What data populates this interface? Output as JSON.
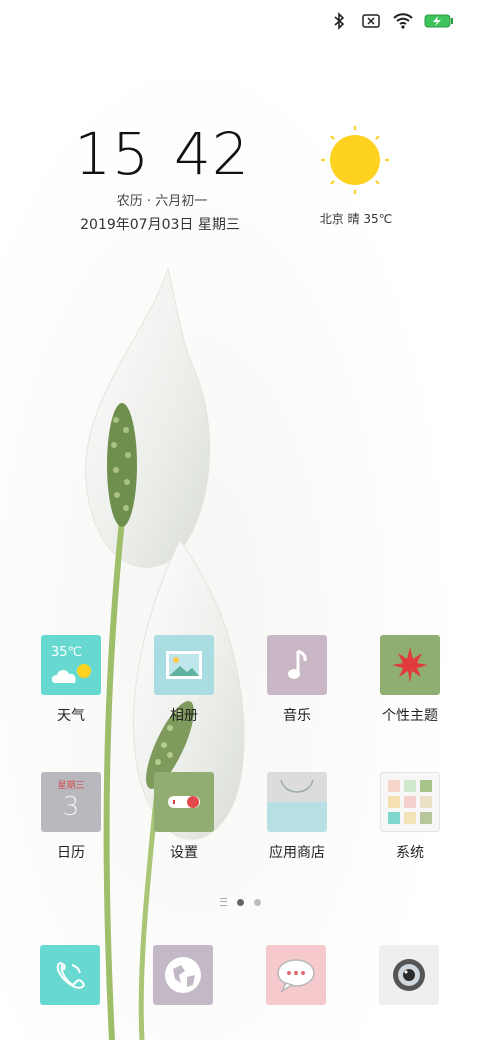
{
  "status_bar": {
    "icons": [
      "bluetooth-icon",
      "no-sim-icon",
      "wifi-icon",
      "battery-charging-icon"
    ]
  },
  "clock": {
    "hours": "15",
    "minutes": "42",
    "lunar_date": "农历 · 六月初一",
    "date": "2019年07月03日  星期三"
  },
  "weather": {
    "icon": "sun-icon",
    "text": "北京   晴   35℃"
  },
  "apps_row1": [
    {
      "label": "天气",
      "icon": "weather-app-icon",
      "tile_text": "35℃",
      "color": "#67d9d0"
    },
    {
      "label": "相册",
      "icon": "gallery-app-icon",
      "color": "#a9dde2"
    },
    {
      "label": "音乐",
      "icon": "music-app-icon",
      "color": "#c9b7c6"
    },
    {
      "label": "个性主题",
      "icon": "themes-app-icon",
      "color": "#8fae72"
    }
  ],
  "apps_row2": [
    {
      "label": "日历",
      "icon": "calendar-app-icon",
      "tile_text": "星期三",
      "tile_number": "3",
      "color": "#b7b9be"
    },
    {
      "label": "设置",
      "icon": "settings-app-icon",
      "color": "#92ad72"
    },
    {
      "label": "应用商店",
      "icon": "app-store-icon",
      "color": "#b8dfe3"
    },
    {
      "label": "系统",
      "icon": "system-folder-icon",
      "color": "#f7f7f7"
    }
  ],
  "page_indicator": {
    "pages": 2,
    "active": 1
  },
  "dock": [
    {
      "icon": "phone-icon",
      "color": "#67d9d0"
    },
    {
      "icon": "browser-globe-icon",
      "color": "#c3b8c6"
    },
    {
      "icon": "messages-icon",
      "color": "#f6c9cd"
    },
    {
      "icon": "camera-icon",
      "color": "#efefef"
    }
  ]
}
